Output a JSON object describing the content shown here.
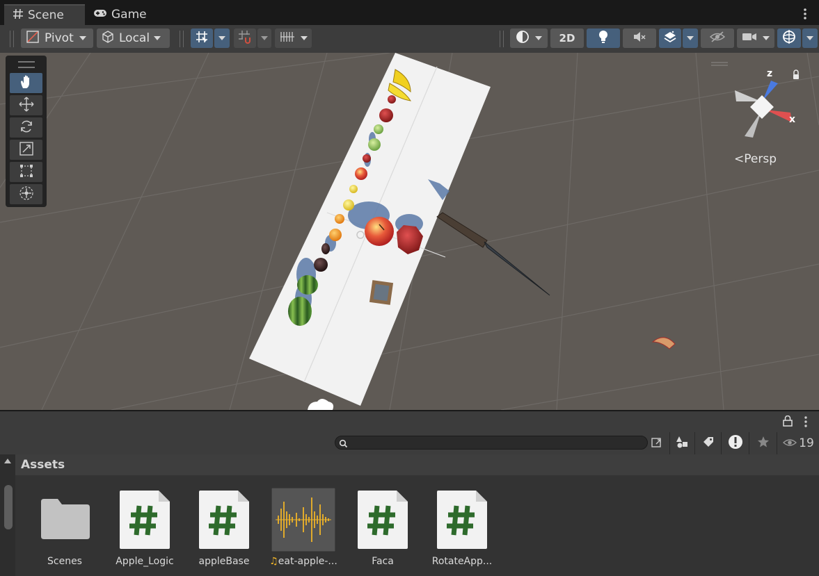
{
  "tabs": [
    {
      "label": "Scene",
      "icon": "hash-icon",
      "active": true
    },
    {
      "label": "Game",
      "icon": "gamepad-icon",
      "active": false
    }
  ],
  "toolbar": {
    "pivot_label": "Pivot",
    "local_label": "Local",
    "mode_2d_label": "2D"
  },
  "scene": {
    "view_label": "Persp",
    "gizmo_axes": {
      "z": "z",
      "x": "x"
    }
  },
  "project": {
    "search_placeholder": "",
    "visible_count": "19",
    "breadcrumb": "Assets",
    "assets": [
      {
        "name": "Scenes",
        "type": "folder"
      },
      {
        "name": "Apple_Logic",
        "type": "script"
      },
      {
        "name": "appleBase",
        "type": "script"
      },
      {
        "name": "eat-apple-...",
        "type": "audio"
      },
      {
        "name": "Faca",
        "type": "script"
      },
      {
        "name": "RotateApp...",
        "type": "script"
      }
    ]
  },
  "colors": {
    "accent": "#46607c",
    "script_hash": "#2e6b2c",
    "audio_wave": "#f0b428"
  }
}
